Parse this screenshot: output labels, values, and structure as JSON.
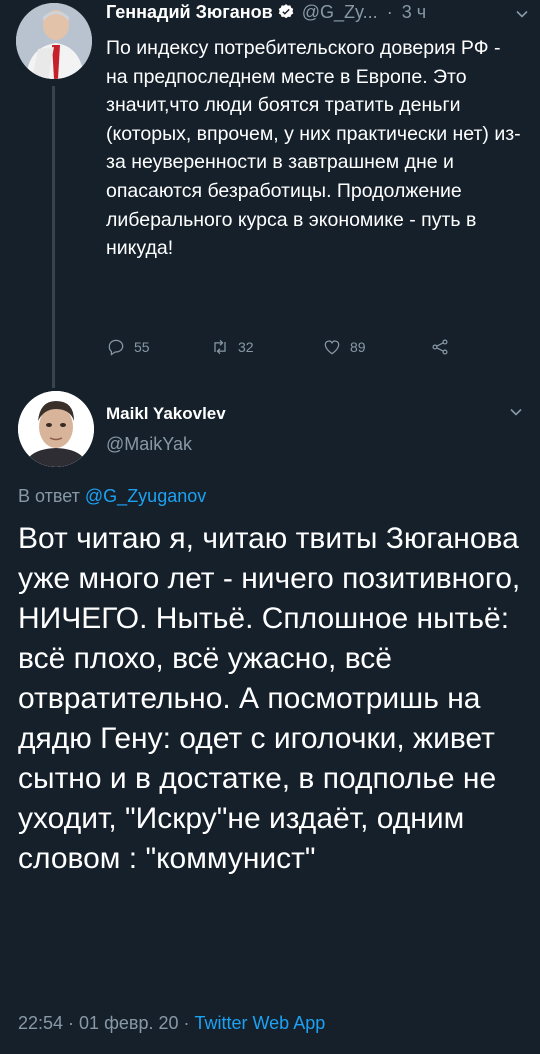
{
  "tweet1": {
    "author_name": "Геннадий Зюганов",
    "handle": "@G_Zy...",
    "dot": "·",
    "time": "3 ч",
    "text": "По индексу потребительского доверия РФ - на предпоследнем месте в Европе. Это значит,что люди боятся тратить деньги (которых, впрочем, у них практически нет) из-за неуверенности в завтрашнем дне и опасаются безработицы. Продолжение либерального курса в экономике - путь в никуда!",
    "replies": "55",
    "retweets": "32",
    "likes": "89"
  },
  "tweet2": {
    "author_name": "Maikl Yakovlev",
    "handle": "@MaikYak",
    "reply_prefix": "В ответ",
    "reply_to": "@G_Zyuganov",
    "text": "Вот читаю я, читаю твиты Зюганова уже много лет - ничего позитивного, НИЧЕГО. Нытьё. Сплошное нытьё: всё плохо, всё ужасно, всё отвратительно. А посмотришь на дядю Гену: одет с иголочки, живет сытно и в достатке, в подполье не уходит, \"Искру\"не издаёт, одним словом : \"коммунист\"",
    "timestamp": "22:54 · 01 февр. 20 ·",
    "source": "Twitter Web App"
  },
  "colors": {
    "background": "#15202b",
    "muted_text": "#8899a6",
    "link": "#1da1f2",
    "thread_line": "#38444d"
  }
}
